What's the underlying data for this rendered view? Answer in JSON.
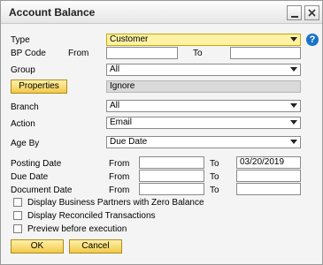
{
  "window": {
    "title": "Account Balance"
  },
  "help_icon": "question-mark-icon",
  "form": {
    "type_label": "Type",
    "type_value": "Customer",
    "bp_code_label": "BP Code",
    "from_label": "From",
    "to_label": "To",
    "bp_from_value": "",
    "bp_to_value": "",
    "group_label": "Group",
    "group_value": "All",
    "properties_button": "Properties",
    "properties_value": "Ignore",
    "branch_label": "Branch",
    "branch_value": "All",
    "action_label": "Action",
    "action_value": "Email",
    "age_by_label": "Age By",
    "age_by_value": "Due Date",
    "posting_date_label": "Posting Date",
    "posting_from_value": "",
    "posting_to_value": "03/20/2019",
    "due_date_label": "Due Date",
    "due_from_value": "",
    "due_to_value": "",
    "document_date_label": "Document Date",
    "doc_from_value": "",
    "doc_to_value": ""
  },
  "options": {
    "zero_balance_label": "Display Business Partners with Zero Balance",
    "reconciled_label": "Display Reconciled Transactions",
    "preview_label": "Preview before execution"
  },
  "buttons": {
    "ok": "OK",
    "cancel": "Cancel"
  },
  "colors": {
    "accent_yellow": "#fdf2a6",
    "button_gold": "#f2c94a",
    "help_blue": "#1a73c9"
  }
}
